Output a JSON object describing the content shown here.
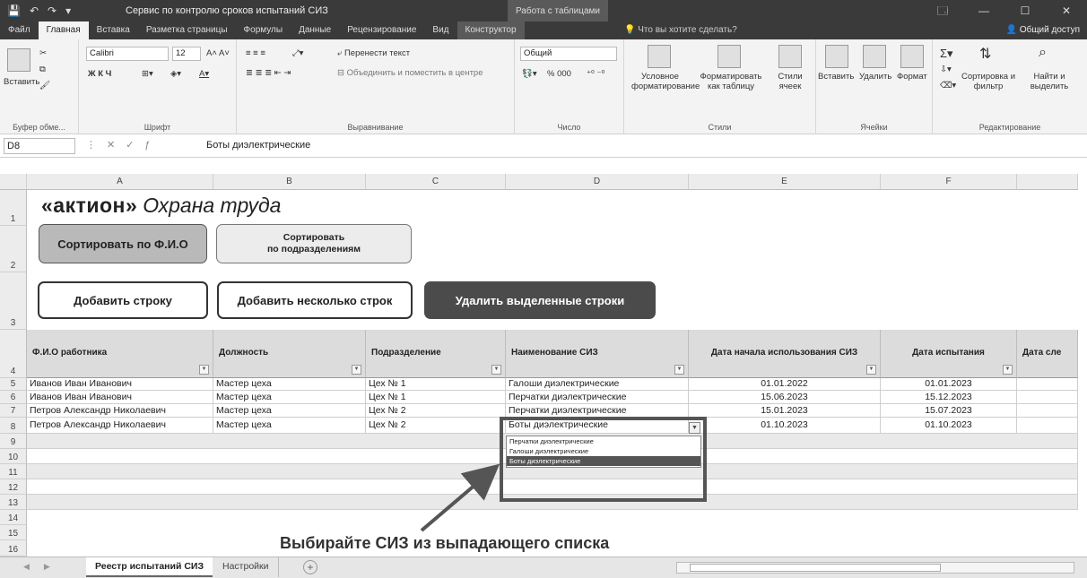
{
  "window": {
    "title": "Сервис по контролю сроков испытаний СИЗ",
    "context_title": "Работа с таблицами",
    "controls": [
      "🗔",
      "—",
      "☐",
      "✕"
    ]
  },
  "ribbon_tabs": [
    "Файл",
    "Главная",
    "Вставка",
    "Разметка страницы",
    "Формулы",
    "Данные",
    "Рецензирование",
    "Вид",
    "Конструктор"
  ],
  "tell_me": "Что вы хотите сделать?",
  "share": "Общий доступ",
  "ribbon": {
    "clipboard": {
      "paste": "Вставить",
      "label": "Буфер обме..."
    },
    "font": {
      "name": "Calibri",
      "size": "12",
      "label": "Шрифт",
      "styles": "Ж  К  Ч"
    },
    "alignment": {
      "wrap": "Перенести текст",
      "merge": "Объединить и поместить в центре",
      "label": "Выравнивание"
    },
    "number": {
      "format": "Общий",
      "percent": "%  000",
      "label": "Число"
    },
    "styles": {
      "conditional": "Условное форматирование",
      "as_table": "Форматировать как таблицу",
      "cell_styles": "Стили ячеек",
      "label": "Стили"
    },
    "cells": {
      "insert": "Вставить",
      "delete": "Удалить",
      "format": "Формат",
      "label": "Ячейки"
    },
    "editing": {
      "sort": "Сортировка и фильтр",
      "find": "Найти и выделить",
      "label": "Редактирование"
    }
  },
  "formula_bar": {
    "cell_ref": "D8",
    "value": "Боты диэлектрические"
  },
  "columns": [
    "A",
    "B",
    "C",
    "D",
    "E",
    "F"
  ],
  "row_numbers": [
    "1",
    "2",
    "3",
    "4",
    "5",
    "6",
    "7",
    "8",
    "9",
    "10",
    "11",
    "12",
    "13",
    "14",
    "15",
    "16"
  ],
  "logo": {
    "brand": "«актион»",
    "subtitle": "Охрана труда"
  },
  "buttons": {
    "sort_name": "Сортировать по Ф.И.О",
    "sort_dept_1": "Сортировать",
    "sort_dept_2": "по подразделениям",
    "add_row": "Добавить строку",
    "add_rows": "Добавить несколько строк",
    "delete_rows": "Удалить выделенные строки"
  },
  "table": {
    "headers": [
      "Ф.И.О работника",
      "Должность",
      "Подразделение",
      "Наименование СИЗ",
      "Дата начала использования СИЗ",
      "Дата испытания",
      "Дата сле"
    ],
    "rows": [
      [
        "Иванов Иван Иванович",
        "Мастер цеха",
        "Цех № 1",
        "Галоши диэлектрические",
        "01.01.2022",
        "01.01.2023"
      ],
      [
        "Иванов Иван Иванович",
        "Мастер цеха",
        "Цех № 1",
        "Перчатки диэлектрические",
        "15.06.2023",
        "15.12.2023"
      ],
      [
        "Петров Александр Николаевич",
        "Мастер цеха",
        "Цех № 2",
        "Перчатки диэлектрические",
        "15.01.2023",
        "15.07.2023"
      ],
      [
        "Петров Александр Николаевич",
        "Мастер цеха",
        "Цех № 2",
        "Боты диэлектрические",
        "01.10.2023",
        "01.10.2023"
      ]
    ]
  },
  "dropdown": {
    "options": [
      "Перчатки диэлектрические",
      "Галоши диэлектрические",
      "Боты диэлектрические"
    ],
    "selected_index": 2
  },
  "hint": "Выбирайте СИЗ из выпадающего списка",
  "sheet_tabs": [
    "Реестр испытаний СИЗ",
    "Настройки"
  ],
  "colors": {
    "dark_button": "#4b4b4b",
    "grey_button": "#b9b9b9",
    "header_fill": "#dcdcdc",
    "title_bar": "#3a3a3a"
  }
}
